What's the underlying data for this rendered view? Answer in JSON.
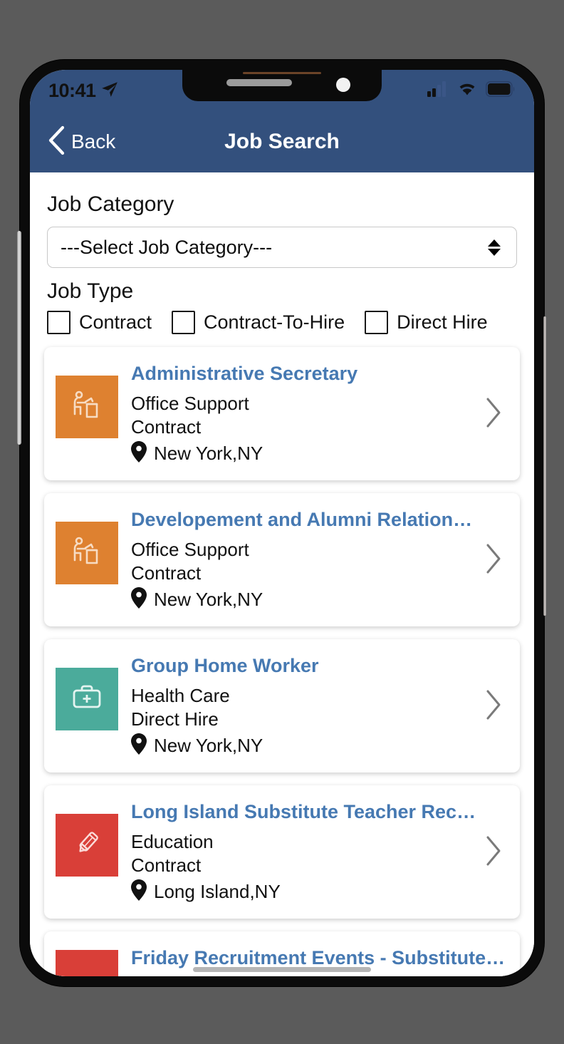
{
  "status_bar": {
    "time": "10:41",
    "location_arrow_icon": "location-arrow-icon",
    "cellular_icon": "cellular-signal-icon",
    "wifi_icon": "wifi-icon",
    "battery_icon": "battery-full-icon",
    "signal_bars_filled": 2,
    "signal_bars_total": 4
  },
  "navbar": {
    "back_label": "Back",
    "back_icon": "chevron-left-icon",
    "title": "Job Search",
    "bg_color": "#33507d"
  },
  "filters": {
    "category_label": "Job Category",
    "category_selected": "---Select Job Category---",
    "category_placeholder": "---Select Job Category---",
    "stepper_icon": "up-down-stepper-icon",
    "jobtype_label": "Job Type",
    "job_types": [
      {
        "label": "Contract",
        "checked": false
      },
      {
        "label": "Contract-To-Hire",
        "checked": false
      },
      {
        "label": "Direct Hire",
        "checked": false
      }
    ]
  },
  "jobs": [
    {
      "title": "Administrative Secretary",
      "category": "Office Support",
      "type": "Contract",
      "location": "New York,NY",
      "tile_color": "#de8130",
      "tile_icon": "office-desk-worker-icon",
      "chevron_icon": "chevron-right-icon",
      "pin_icon": "map-pin-icon"
    },
    {
      "title": "Developement and Alumni Relations Associ...",
      "category": "Office Support",
      "type": "Contract",
      "location": "New York,NY",
      "tile_color": "#de8130",
      "tile_icon": "office-desk-worker-icon",
      "chevron_icon": "chevron-right-icon",
      "pin_icon": "map-pin-icon"
    },
    {
      "title": "Group Home Worker",
      "category": "Health Care",
      "type": "Direct Hire",
      "location": "New York,NY",
      "tile_color": "#4bab9b",
      "tile_icon": "first-aid-kit-icon",
      "chevron_icon": "chevron-right-icon",
      "pin_icon": "map-pin-icon"
    },
    {
      "title": "Long Island Substitute Teacher Recruitmen...",
      "category": "Education",
      "type": "Contract",
      "location": "Long Island,NY",
      "tile_color": "#d93f38",
      "tile_icon": "pencil-icon",
      "chevron_icon": "chevron-right-icon",
      "pin_icon": "map-pin-icon"
    },
    {
      "title": "Friday Recruitment Events - Substitute Edu",
      "category": "",
      "type": "",
      "location": "",
      "tile_color": "#d93f38",
      "tile_icon": "pencil-icon",
      "chevron_icon": "chevron-right-icon",
      "pin_icon": "map-pin-icon"
    }
  ],
  "theme": {
    "header_blue": "#33507d",
    "link_blue": "#4679b2",
    "page_bg": "#ffffff",
    "frame_black": "#0b0b0b",
    "backdrop_gray": "#5b5b5b"
  }
}
